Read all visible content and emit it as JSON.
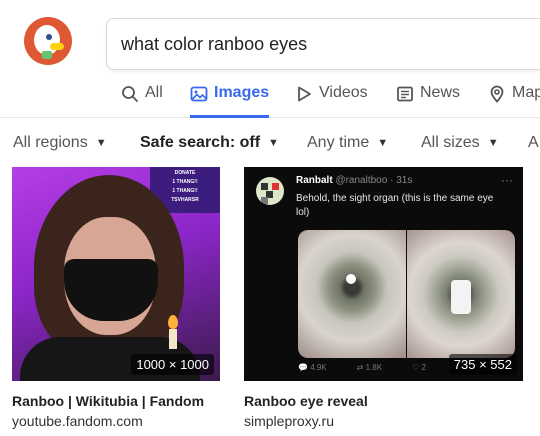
{
  "search": {
    "query": "what color ranboo eyes"
  },
  "tabs": [
    {
      "label": "All",
      "icon": "search-icon",
      "active": false
    },
    {
      "label": "Images",
      "icon": "image-icon",
      "active": true
    },
    {
      "label": "Videos",
      "icon": "play-icon",
      "active": false
    },
    {
      "label": "News",
      "icon": "newspaper-icon",
      "active": false
    },
    {
      "label": "Maps",
      "icon": "map-pin-icon",
      "active": false
    }
  ],
  "filters": [
    {
      "label": "All regions",
      "caret": "▼"
    },
    {
      "label": "Safe search: off",
      "caret": "▼"
    },
    {
      "label": "Any time",
      "caret": "▼"
    },
    {
      "label": "All sizes",
      "caret": "▼"
    },
    {
      "label": "A"
    }
  ],
  "results": [
    {
      "title": "Ranboo | Wikitubia | Fandom",
      "source": "youtube.fandom.com",
      "dimensions": "1000 × 1000",
      "image_text": [
        "DONATE",
        "1 THANG!!",
        "1 THANG!!",
        "TSVHARSR"
      ]
    },
    {
      "title": "Ranboo eye reveal",
      "source": "simpleproxy.ru",
      "dimensions": "735 × 552",
      "tweet": {
        "name": "Ranbalt",
        "handle": "@ranaltboo · 31s",
        "text": "Behold, the sight organ (this is the same eye lol)",
        "replies": "4.9K",
        "retweets": "1.8K",
        "likes": "2"
      }
    }
  ],
  "colors": {
    "accent": "#3969ef",
    "brand": "#de5833"
  }
}
